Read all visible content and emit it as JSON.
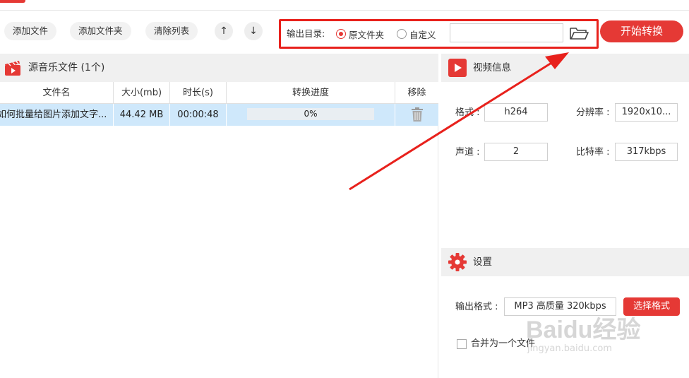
{
  "toolbar": {
    "add_file": "添加文件",
    "add_folder": "添加文件夹",
    "clear_list": "清除列表",
    "up": "↑",
    "down": "↓"
  },
  "output": {
    "label": "输出目录:",
    "option_original": "原文件夹",
    "option_custom": "自定义",
    "selected": "原文件夹",
    "path_value": ""
  },
  "start_label": "开始转换",
  "source_panel": {
    "title": "源音乐文件 (1个)",
    "columns": [
      "文件名",
      "大小(mb)",
      "时长(s)",
      "转换进度",
      "移除"
    ],
    "rows": [
      {
        "name": "如何批量给图片添加文字...",
        "size": "44.42 MB",
        "duration": "00:00:48",
        "progress": "0%",
        "progress_value": 0
      }
    ]
  },
  "video_info": {
    "title": "视频信息",
    "format_label": "格式 :",
    "format_value": "h264",
    "resolution_label": "分辨率 :",
    "resolution_value": "1920x10...",
    "channel_label": "声道 :",
    "channel_value": "2",
    "bitrate_label": "比特率 :",
    "bitrate_value": "317kbps"
  },
  "settings": {
    "title": "设置",
    "output_format_label": "输出格式 :",
    "output_format_value": "MP3 高质量 320kbps",
    "select_format_label": "选择格式",
    "merge_label": "合并为一个文件",
    "merge_checked": false
  },
  "watermark": {
    "brand": "Baidu经验",
    "url": "jingyan.baidu.com"
  },
  "colors": {
    "accent": "#e53935",
    "highlight": "#e8211c",
    "row_selected": "#cfe8fb",
    "panel_header": "#f0f0f0"
  }
}
